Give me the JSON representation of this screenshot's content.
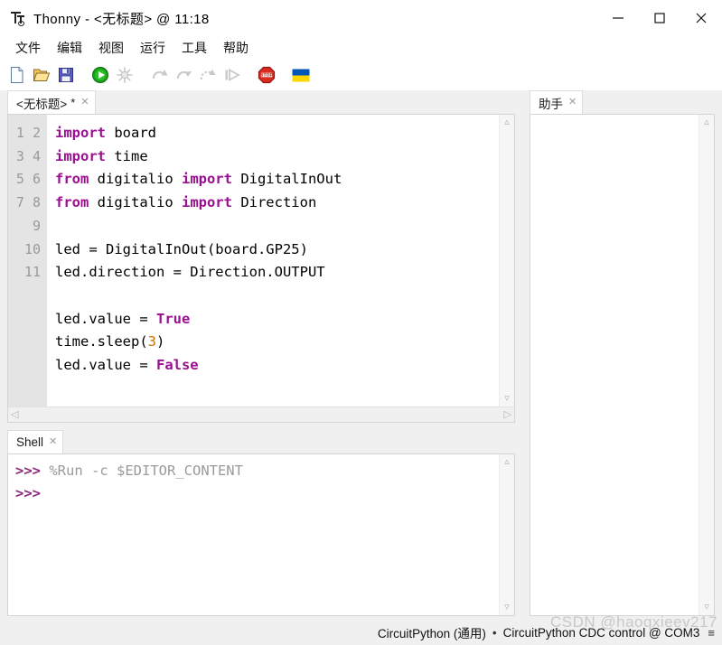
{
  "window": {
    "app_name": "Thonny",
    "title": "Thonny  -  <无标题>  @  11:18",
    "logo_icon": "thonny-logo-icon",
    "controls": {
      "minimize": "minimize-icon",
      "maximize": "maximize-icon",
      "close": "close-icon"
    }
  },
  "menubar": {
    "items": [
      {
        "label": "文件",
        "name": "menu-file"
      },
      {
        "label": "编辑",
        "name": "menu-edit"
      },
      {
        "label": "视图",
        "name": "menu-view"
      },
      {
        "label": "运行",
        "name": "menu-run"
      },
      {
        "label": "工具",
        "name": "menu-tools"
      },
      {
        "label": "帮助",
        "name": "menu-help"
      }
    ]
  },
  "toolbar": {
    "buttons": [
      {
        "icon": "new-file-icon",
        "name": "toolbar-new-file",
        "enabled": true
      },
      {
        "icon": "open-folder-icon",
        "name": "toolbar-open-file",
        "enabled": true
      },
      {
        "icon": "save-icon",
        "name": "toolbar-save-file",
        "enabled": true
      },
      {
        "icon": "run-icon",
        "name": "toolbar-run",
        "enabled": true
      },
      {
        "icon": "debug-icon",
        "name": "toolbar-debug",
        "enabled": false
      },
      {
        "icon": "step-over-icon",
        "name": "toolbar-step-over",
        "enabled": false
      },
      {
        "icon": "step-into-icon",
        "name": "toolbar-step-into",
        "enabled": false
      },
      {
        "icon": "step-out-icon",
        "name": "toolbar-step-out",
        "enabled": false
      },
      {
        "icon": "resume-icon",
        "name": "toolbar-resume",
        "enabled": false
      },
      {
        "icon": "stop-icon",
        "name": "toolbar-stop",
        "enabled": true
      },
      {
        "icon": "ukraine-flag-icon",
        "name": "toolbar-ukraine-flag",
        "enabled": true
      }
    ],
    "stop_label": "STOP"
  },
  "editor": {
    "tab": {
      "label": "<无标题>",
      "modified_marker": "*",
      "close_icon": "close-icon"
    },
    "line_numbers": [
      "1",
      "2",
      "3",
      "4",
      "5",
      "6",
      "7",
      "8",
      "9",
      "10",
      "11"
    ],
    "lines": [
      {
        "n": 1,
        "text": "import board"
      },
      {
        "n": 2,
        "text": "import time"
      },
      {
        "n": 3,
        "text": "from digitalio import DigitalInOut"
      },
      {
        "n": 4,
        "text": "from digitalio import Direction"
      },
      {
        "n": 5,
        "text": ""
      },
      {
        "n": 6,
        "text": "led = DigitalInOut(board.GP25)"
      },
      {
        "n": 7,
        "text": "led.direction = Direction.OUTPUT"
      },
      {
        "n": 8,
        "text": ""
      },
      {
        "n": 9,
        "text": "led.value = True"
      },
      {
        "n": 10,
        "text": "time.sleep(3)"
      },
      {
        "n": 11,
        "text": "led.value = False"
      }
    ],
    "syntax_colors": {
      "keyword": "#9a0f8f",
      "number": "#cc7000",
      "builtin_constant": "#9a0f8f",
      "text": "#000000",
      "gutter_bg": "#e4e4e4",
      "gutter_fg": "#9a9a9a"
    }
  },
  "shell": {
    "tab": {
      "label": "Shell",
      "close_icon": "close-icon"
    },
    "lines": [
      {
        "prompt": ">>>",
        "command": "%Run -c $EDITOR_CONTENT"
      },
      {
        "prompt": ">>>",
        "command": ""
      }
    ],
    "prompt_color": "#8b2a7a",
    "command_color": "#9a9a9a"
  },
  "assistant": {
    "tab": {
      "label": "助手",
      "close_icon": "close-icon"
    },
    "content": ""
  },
  "statusbar": {
    "interpreter": "CircuitPython (通用)",
    "separator": "•",
    "device": "CircuitPython CDC control @ COM3",
    "menu_icon": "hamburger-icon",
    "watermark": "CSDN @haoqxieev217"
  },
  "scrollbars": {
    "up_arrow": "⌃",
    "down_arrow": "⌄",
    "left_arrow": "‹",
    "right_arrow": "›"
  }
}
